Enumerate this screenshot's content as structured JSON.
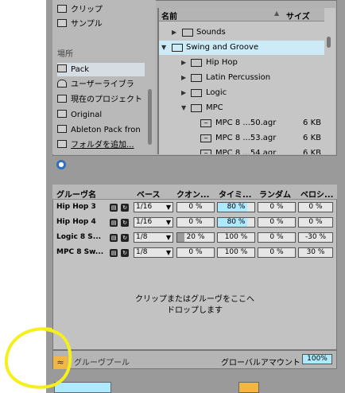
{
  "places": {
    "items": [
      {
        "label": "クリップ",
        "icon": "clip-icon"
      },
      {
        "label": "サンプル",
        "icon": "waveform-icon"
      },
      {
        "label": "場所",
        "icon": ""
      },
      {
        "label": "Pack",
        "icon": "pack-icon",
        "selected": true
      },
      {
        "label": "ユーザーライブラ",
        "icon": "user-icon"
      },
      {
        "label": "現在のプロジェクト",
        "icon": "project-icon"
      },
      {
        "label": "Original",
        "icon": "folder-icon"
      },
      {
        "label": "Ableton Pack fron",
        "icon": "folder-icon"
      },
      {
        "label": "フォルダを追加...",
        "icon": "add-folder-icon"
      }
    ]
  },
  "files": {
    "col_name": "名前",
    "col_size": "サイズ",
    "rows": [
      {
        "name": "Sounds",
        "type": "folder",
        "state": "collapsed",
        "indent": 1,
        "size": ""
      },
      {
        "name": "Swing and Groove",
        "type": "folder",
        "state": "expanded",
        "indent": 0,
        "size": "",
        "selected": true
      },
      {
        "name": "Hip Hop",
        "type": "folder",
        "state": "collapsed",
        "indent": 1,
        "size": ""
      },
      {
        "name": "Latin Percussion",
        "type": "folder",
        "state": "collapsed",
        "indent": 1,
        "size": ""
      },
      {
        "name": "Logic",
        "type": "folder",
        "state": "collapsed",
        "indent": 1,
        "size": ""
      },
      {
        "name": "MPC",
        "type": "folder",
        "state": "expanded",
        "indent": 1,
        "size": ""
      },
      {
        "name": "MPC 8 ...50.agr",
        "type": "file",
        "indent": 2,
        "size": "6 KB"
      },
      {
        "name": "MPC 8 ...53.agr",
        "type": "file",
        "indent": 2,
        "size": "6 KB"
      },
      {
        "name": "MPC 8 ...54.agr",
        "type": "file",
        "indent": 2,
        "size": "6 KB"
      }
    ]
  },
  "groove": {
    "headers": [
      "グルーヴ名",
      "ベース",
      "クオン...",
      "タイミ...",
      "ランダム",
      "ベロシ..."
    ],
    "rows": [
      {
        "name": "Hip Hop 3",
        "base": "1/16",
        "quantize": "0 %",
        "quantize_level": 0,
        "timing": "80 %",
        "timing_level": 0.8,
        "random": "0 %",
        "velocity": "0 %"
      },
      {
        "name": "Hip Hop 4",
        "base": "1/16",
        "quantize": "0 %",
        "quantize_level": 0,
        "timing": "80 %",
        "timing_level": 0.8,
        "random": "0 %",
        "velocity": "0 %"
      },
      {
        "name": "Logic 8 S...",
        "base": "1/8",
        "quantize": "20 %",
        "quantize_level": 0.2,
        "timing": "100 %",
        "timing_level": 0,
        "random": "0 %",
        "velocity": "-30 %"
      },
      {
        "name": "MPC 8 Sw...",
        "base": "1/8",
        "quantize": "0 %",
        "quantize_level": 0,
        "timing": "100 %",
        "timing_level": 0,
        "random": "0 %",
        "velocity": "30 %"
      }
    ],
    "drop_line1": "クリップまたはグルーヴをここへ",
    "drop_line2": "ドロップします",
    "tab_label": "グルーヴプール",
    "global_label": "グローバルアマウント",
    "global_value": "100%"
  },
  "colors": {
    "accent_blue": "#aeeaff",
    "accent_orange": "#f2b742",
    "annotation_yellow": "#f5ef1c",
    "selection": "#ccebf6"
  }
}
